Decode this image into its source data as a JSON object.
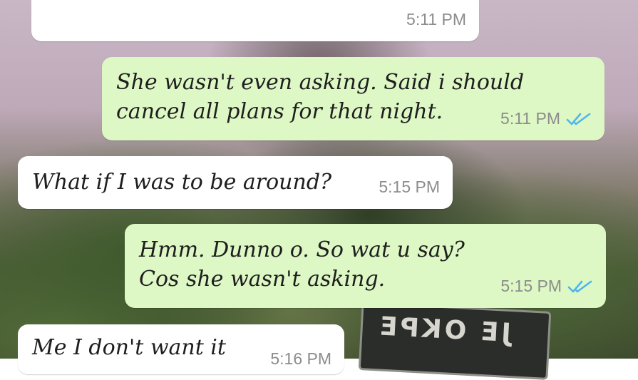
{
  "colors": {
    "incoming_bubble": "#ffffff",
    "outgoing_bubble": "#ddf7c5",
    "read_ticks": "#4fb6ec",
    "timestamp": "#8c8c8c"
  },
  "background": {
    "patch_text": "JE OKPE"
  },
  "messages": [
    {
      "direction": "incoming",
      "lines": [
        ""
      ],
      "time": "5:11 PM",
      "read_receipt": null
    },
    {
      "direction": "outgoing",
      "lines": [
        "She wasn't even asking. Said i should",
        "cancel all plans for that night."
      ],
      "time": "5:11 PM",
      "read_receipt": "double-check-icon"
    },
    {
      "direction": "incoming",
      "lines": [
        "What if I was to be around?"
      ],
      "time": "5:15 PM",
      "read_receipt": null
    },
    {
      "direction": "outgoing",
      "lines": [
        "Hmm. Dunno o. So wat u say?",
        "Cos she wasn't asking."
      ],
      "time": "5:15 PM",
      "read_receipt": "double-check-icon"
    },
    {
      "direction": "incoming",
      "lines": [
        "Me I don't want it"
      ],
      "time": "5:16 PM",
      "read_receipt": null
    }
  ]
}
